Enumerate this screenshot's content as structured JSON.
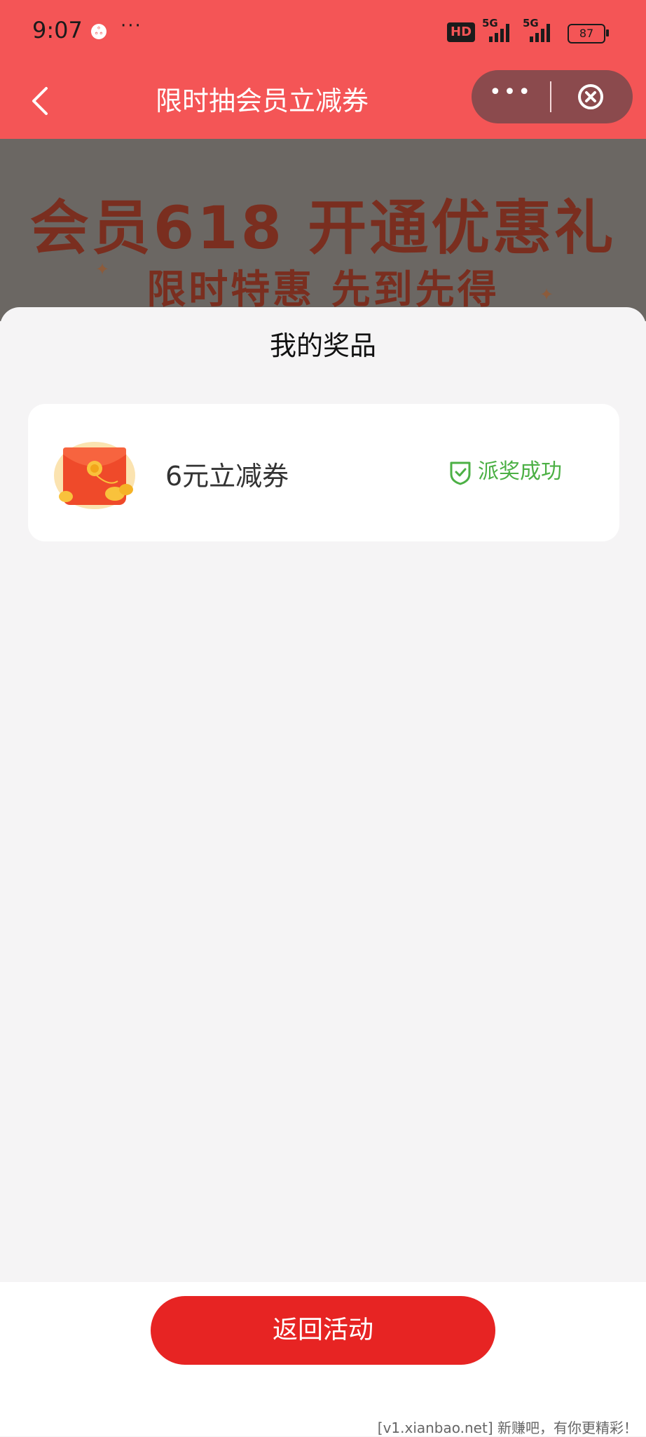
{
  "status_bar": {
    "time": "9:07",
    "app_icon": "baidu-paw-icon",
    "more": "···",
    "hd": "HD",
    "network1": "5G",
    "network2": "5G",
    "battery": "87"
  },
  "nav": {
    "title": "限时抽会员立减券",
    "back_icon": "chevron-left-icon",
    "more": "•••",
    "close_icon": "close-circle-icon"
  },
  "banner": {
    "title": "会员618  开通优惠礼",
    "subtitle": "限时特惠 先到先得"
  },
  "sheet": {
    "title": "我的奖品",
    "prizes": [
      {
        "name": "6元立减券",
        "status": "派奖成功",
        "icon": "red-envelope-icon",
        "status_icon": "shield-check-icon"
      }
    ]
  },
  "footer": {
    "button": "返回活动",
    "watermark": "[v1.xianbao.net] 新赚吧，有你更精彩！"
  },
  "colors": {
    "header": "#f45556",
    "button": "#e72423",
    "success": "#4cb045"
  }
}
